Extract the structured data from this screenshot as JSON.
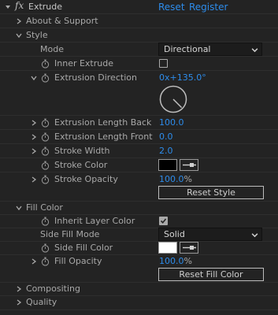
{
  "header": {
    "fx_label": "fx",
    "effect_name": "Extrude",
    "reset_label": "Reset",
    "register_label": "Register"
  },
  "groups": {
    "about": "About & Support",
    "style": "Style",
    "fill_color": "Fill Color",
    "compositing": "Compositing",
    "quality": "Quality"
  },
  "style": {
    "mode_label": "Mode",
    "mode_value": "Directional",
    "inner_extrude_label": "Inner Extrude",
    "inner_extrude_checked": false,
    "extrusion_direction_label": "Extrusion Direction",
    "extrusion_direction_value": "0x+135.0°",
    "extrusion_direction_angle": 135,
    "extrusion_length_back_label": "Extrusion Length Back",
    "extrusion_length_back_value": "100.0",
    "extrusion_length_front_label": "Extrusion Length Front",
    "extrusion_length_front_value": "0.0",
    "stroke_width_label": "Stroke Width",
    "stroke_width_value": "2.0",
    "stroke_color_label": "Stroke Color",
    "stroke_color": "#000000",
    "stroke_opacity_label": "Stroke Opacity",
    "stroke_opacity_value": "100.0",
    "stroke_opacity_unit": "%",
    "reset_style_label": "Reset Style"
  },
  "fill": {
    "inherit_layer_color_label": "Inherit Layer Color",
    "inherit_layer_color_checked": true,
    "side_fill_mode_label": "Side Fill Mode",
    "side_fill_mode_value": "Solid",
    "side_fill_color_label": "Side Fill Color",
    "side_fill_color": "#ffffff",
    "fill_opacity_label": "Fill Opacity",
    "fill_opacity_value": "100.0",
    "fill_opacity_unit": "%",
    "reset_fill_color_label": "Reset Fill Color"
  },
  "colors": {
    "accent": "#2d8ceb",
    "background": "#232323",
    "text": "#a8a8a8"
  }
}
